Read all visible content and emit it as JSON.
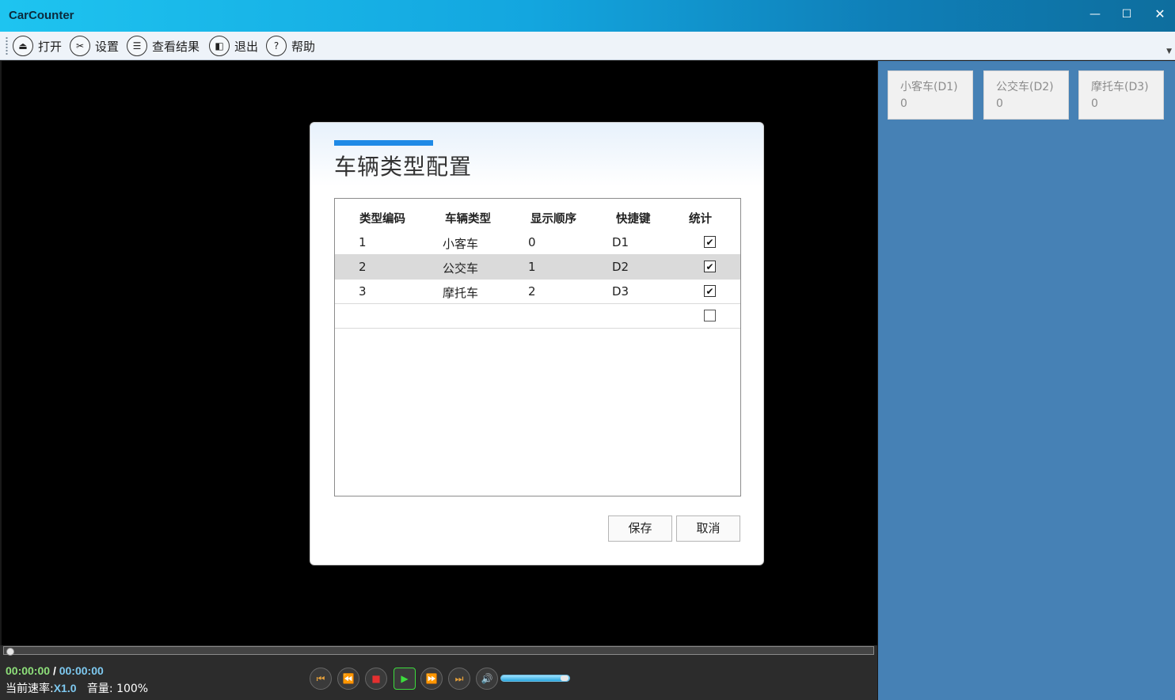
{
  "window": {
    "title": "CarCounter",
    "minimize": "🗕",
    "maximize": "🗖",
    "close": "✕"
  },
  "toolbar": {
    "items": [
      {
        "label": "打开",
        "icon": "eject-icon",
        "glyph": "⏏"
      },
      {
        "label": "设置",
        "icon": "tools-icon",
        "glyph": "✂"
      },
      {
        "label": "查看结果",
        "icon": "list-icon",
        "glyph": "☰"
      },
      {
        "label": "退出",
        "icon": "exit-icon",
        "glyph": "◧"
      },
      {
        "label": "帮助",
        "icon": "help-icon",
        "glyph": "?"
      }
    ]
  },
  "counters": [
    {
      "label": "小客车(D1)",
      "count": "0"
    },
    {
      "label": "公交车(D2)",
      "count": "0"
    },
    {
      "label": "摩托车(D3)",
      "count": "0"
    }
  ],
  "player": {
    "current_time": "00:00:00",
    "separator": "/",
    "total_time": "00:00:00",
    "rate_label": "当前速率:",
    "rate_value": "X1.0",
    "volume_label": "音量:",
    "volume_value": "100%",
    "volume_level": 0.9,
    "controls": [
      {
        "name": "skip-start-icon",
        "glyph": "⏮",
        "color": "#e8a23b"
      },
      {
        "name": "rewind-icon",
        "glyph": "⏪",
        "color": "#e07ab8"
      },
      {
        "name": "stop-icon",
        "glyph": "■",
        "color": "#e53030"
      },
      {
        "name": "play-icon",
        "glyph": "▶",
        "color": "#3ddc3d"
      },
      {
        "name": "fast-forward-icon",
        "glyph": "⏩",
        "color": "#e07ab8"
      },
      {
        "name": "skip-end-icon",
        "glyph": "⏭",
        "color": "#e8a23b"
      },
      {
        "name": "volume-icon",
        "glyph": "🔊",
        "color": "#e0e0e0"
      }
    ]
  },
  "dialog": {
    "title": "车辆类型配置",
    "columns": [
      "类型编码",
      "车辆类型",
      "显示顺序",
      "快捷键",
      "统计"
    ],
    "rows": [
      {
        "code": "1",
        "type": "小客车",
        "order": "0",
        "hotkey": "D1",
        "checked": true
      },
      {
        "code": "2",
        "type": "公交车",
        "order": "1",
        "hotkey": "D2",
        "checked": true
      },
      {
        "code": "3",
        "type": "摩托车",
        "order": "2",
        "hotkey": "D3",
        "checked": true
      },
      {
        "code": "",
        "type": "",
        "order": "",
        "hotkey": "",
        "checked": false
      }
    ],
    "selected_row": 1,
    "save_label": "保存",
    "cancel_label": "取消"
  },
  "colors": {
    "accent": "#1f8ae6",
    "right_panel": "#4681b5",
    "titlebar_start": "#1ec4f0",
    "titlebar_end": "#0e6e9e"
  }
}
